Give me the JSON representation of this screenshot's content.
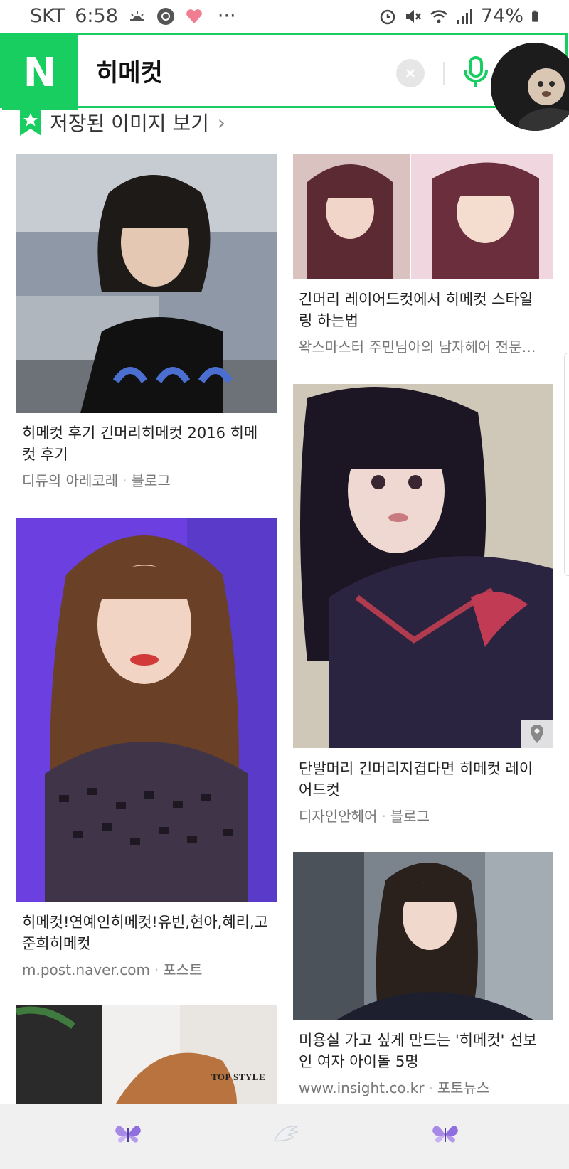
{
  "status_bar": {
    "carrier": "SKT",
    "time": "6:58",
    "more": "···",
    "battery": "74%"
  },
  "search": {
    "logo": "N",
    "query": "히메컷"
  },
  "saved_images": {
    "label": "저장된 이미지 보기",
    "chevron": "›"
  },
  "results": [
    {
      "title": "히메컷 후기 긴머리히메컷 2016 히메컷 후기",
      "source": "디듀의 아레코레",
      "type": "블로그",
      "image": "short-bob-hair-photo"
    },
    {
      "title": "긴머리 레이어드컷에서 히메컷 스타일링 하는법",
      "source": "왁스마스터 주민님아의 남자헤어 전문블...",
      "type": "",
      "image": "two-panel-pink-hair-photo"
    },
    {
      "title": "단발머리 긴머리지겹다면 히메컷 레이어드컷",
      "source": "디자인안헤어",
      "type": "블로그",
      "image": "long-black-hair-sailor-uniform-photo"
    },
    {
      "title": "히메컷!연예인히메컷!유빈,현아,혜리,고준희히메컷",
      "source": "m.post.naver.com",
      "type": "포스트",
      "image": "long-brown-hair-photo"
    },
    {
      "title": "미용실 가고 싶게 만드는 '히메컷' 선보인 여자 아이돌 5명",
      "source": "www.insight.co.kr",
      "type": "포토뉴스",
      "image": "bangs-hair-street-photo"
    },
    {
      "title": "",
      "source": "",
      "type": "",
      "image": "partial-photo",
      "overlay_text": "TOP STYLE"
    }
  ],
  "bottom_nav": {
    "items": [
      "butterfly-icon",
      "wing-icon",
      "butterfly-icon"
    ]
  },
  "colors": {
    "naver_green": "#19ce60",
    "text": "#222222",
    "muted": "#777777"
  }
}
